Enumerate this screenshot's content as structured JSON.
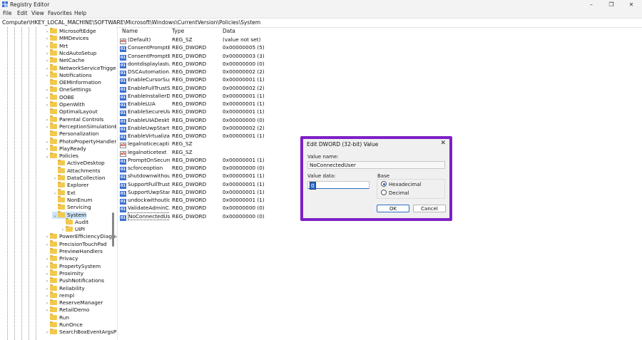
{
  "window": {
    "title": "Registry Editor",
    "minimize": "–",
    "maximize": "❐",
    "close": "✕"
  },
  "menu": [
    "File",
    "Edit",
    "View",
    "Favorites",
    "Help"
  ],
  "address": "Computer\\HKEY_LOCAL_MACHINE\\SOFTWARE\\Microsoft\\Windows\\CurrentVersion\\Policies\\System",
  "tree": [
    {
      "label": "MicrosoftEdge",
      "chev": "›",
      "indent": 0
    },
    {
      "label": "MMDevices",
      "chev": "›",
      "indent": 0
    },
    {
      "label": "Mrt",
      "chev": "›",
      "indent": 0
    },
    {
      "label": "NcdAutoSetup",
      "chev": "›",
      "indent": 0
    },
    {
      "label": "NetCache",
      "chev": "›",
      "indent": 0
    },
    {
      "label": "NetworkServiceTriggers",
      "chev": "›",
      "indent": 0
    },
    {
      "label": "Notifications",
      "chev": "›",
      "indent": 0
    },
    {
      "label": "OEMInformation",
      "chev": "",
      "indent": 0
    },
    {
      "label": "OneSettings",
      "chev": "›",
      "indent": 0
    },
    {
      "label": "OOBE",
      "chev": "›",
      "indent": 0
    },
    {
      "label": "OpenWith",
      "chev": "›",
      "indent": 0
    },
    {
      "label": "OptimalLayout",
      "chev": "",
      "indent": 0
    },
    {
      "label": "Parental Controls",
      "chev": "›",
      "indent": 0
    },
    {
      "label": "PerceptionSimulationExtensions",
      "chev": "›",
      "indent": 0
    },
    {
      "label": "Personalization",
      "chev": "",
      "indent": 0
    },
    {
      "label": "PhotoPropertyHandler",
      "chev": "›",
      "indent": 0
    },
    {
      "label": "PlayReady",
      "chev": "›",
      "indent": 0
    },
    {
      "label": "Policies",
      "chev": "⌄",
      "indent": 0
    },
    {
      "label": "ActiveDesktop",
      "chev": "",
      "indent": 1
    },
    {
      "label": "Attachments",
      "chev": "",
      "indent": 1
    },
    {
      "label": "DataCollection",
      "chev": "›",
      "indent": 1
    },
    {
      "label": "Explorer",
      "chev": "",
      "indent": 1
    },
    {
      "label": "Ext",
      "chev": "›",
      "indent": 1
    },
    {
      "label": "NonEnum",
      "chev": "",
      "indent": 1
    },
    {
      "label": "Servicing",
      "chev": "",
      "indent": 1
    },
    {
      "label": "System",
      "chev": "⌄",
      "indent": 1,
      "selected": true
    },
    {
      "label": "Audit",
      "chev": "",
      "indent": 2
    },
    {
      "label": "UIPI",
      "chev": "›",
      "indent": 2
    },
    {
      "label": "PowerEfficiencyDiagnostics",
      "chev": "›",
      "indent": 0
    },
    {
      "label": "PrecisionTouchPad",
      "chev": "›",
      "indent": 0
    },
    {
      "label": "PreviewHandlers",
      "chev": "",
      "indent": 0
    },
    {
      "label": "Privacy",
      "chev": "›",
      "indent": 0
    },
    {
      "label": "PropertySystem",
      "chev": "›",
      "indent": 0
    },
    {
      "label": "Proximity",
      "chev": "›",
      "indent": 0
    },
    {
      "label": "PushNotifications",
      "chev": "›",
      "indent": 0
    },
    {
      "label": "Reliability",
      "chev": "›",
      "indent": 0
    },
    {
      "label": "rempl",
      "chev": "›",
      "indent": 0
    },
    {
      "label": "ReserveManager",
      "chev": "›",
      "indent": 0
    },
    {
      "label": "RetailDemo",
      "chev": "›",
      "indent": 0
    },
    {
      "label": "Run",
      "chev": "",
      "indent": 0
    },
    {
      "label": "RunOnce",
      "chev": "",
      "indent": 0
    },
    {
      "label": "SearchBoxEventArgsProvider",
      "chev": "›",
      "indent": 0
    }
  ],
  "columns": {
    "name": "Name",
    "type": "Type",
    "data": "Data"
  },
  "values": [
    {
      "name": "(Default)",
      "type": "REG_SZ",
      "data": "(value not set)",
      "kind": "sz"
    },
    {
      "name": "ConsentPromptB...",
      "type": "REG_DWORD",
      "data": "0x00000005 (5)",
      "kind": "dword"
    },
    {
      "name": "ConsentPromptB...",
      "type": "REG_DWORD",
      "data": "0x00000003 (3)",
      "kind": "dword"
    },
    {
      "name": "dontdisplaylastu...",
      "type": "REG_DWORD",
      "data": "0x00000000 (0)",
      "kind": "dword"
    },
    {
      "name": "DSCAutomation...",
      "type": "REG_DWORD",
      "data": "0x00000002 (2)",
      "kind": "dword"
    },
    {
      "name": "EnableCursorSup...",
      "type": "REG_DWORD",
      "data": "0x00000001 (1)",
      "kind": "dword"
    },
    {
      "name": "EnableFullTrustSt...",
      "type": "REG_DWORD",
      "data": "0x00000002 (2)",
      "kind": "dword"
    },
    {
      "name": "EnableInstallerD...",
      "type": "REG_DWORD",
      "data": "0x00000001 (1)",
      "kind": "dword"
    },
    {
      "name": "EnableLUA",
      "type": "REG_DWORD",
      "data": "0x00000001 (1)",
      "kind": "dword"
    },
    {
      "name": "EnableSecureUIA...",
      "type": "REG_DWORD",
      "data": "0x00000001 (1)",
      "kind": "dword"
    },
    {
      "name": "EnableUIADeskt...",
      "type": "REG_DWORD",
      "data": "0x00000000 (0)",
      "kind": "dword"
    },
    {
      "name": "EnableUwpStart...",
      "type": "REG_DWORD",
      "data": "0x00000002 (2)",
      "kind": "dword"
    },
    {
      "name": "EnableVirtualizat...",
      "type": "REG_DWORD",
      "data": "0x00000001 (1)",
      "kind": "dword"
    },
    {
      "name": "legalnoticecapti...",
      "type": "REG_SZ",
      "data": "",
      "kind": "sz"
    },
    {
      "name": "legalnoticetext",
      "type": "REG_SZ",
      "data": "",
      "kind": "sz"
    },
    {
      "name": "PromptOnSecure...",
      "type": "REG_DWORD",
      "data": "0x00000001 (1)",
      "kind": "dword"
    },
    {
      "name": "scforceoption",
      "type": "REG_DWORD",
      "data": "0x00000000 (0)",
      "kind": "dword"
    },
    {
      "name": "shutdownwithou...",
      "type": "REG_DWORD",
      "data": "0x00000001 (1)",
      "kind": "dword"
    },
    {
      "name": "SupportFullTrust...",
      "type": "REG_DWORD",
      "data": "0x00000001 (1)",
      "kind": "dword"
    },
    {
      "name": "SupportUwpStar...",
      "type": "REG_DWORD",
      "data": "0x00000001 (1)",
      "kind": "dword"
    },
    {
      "name": "undockwithoutlo...",
      "type": "REG_DWORD",
      "data": "0x00000001 (1)",
      "kind": "dword"
    },
    {
      "name": "ValidateAdminC...",
      "type": "REG_DWORD",
      "data": "0x00000000 (0)",
      "kind": "dword"
    },
    {
      "name": "NoConnectedUser",
      "type": "REG_DWORD",
      "data": "0x00000000 (0)",
      "kind": "dword",
      "selected": true
    }
  ],
  "dialog": {
    "title": "Edit DWORD (32-bit) Value",
    "close": "✕",
    "value_name_label": "Value name:",
    "value_name": "NoConnectedUser",
    "value_data_label": "Value data:",
    "value_data": "0",
    "base_label": "Base",
    "hex_label": "Hexadecimal",
    "dec_label": "Decimal",
    "base_selected": "Hexadecimal",
    "ok": "OK",
    "cancel": "Cancel",
    "accent_color": "#7d1fc7"
  }
}
